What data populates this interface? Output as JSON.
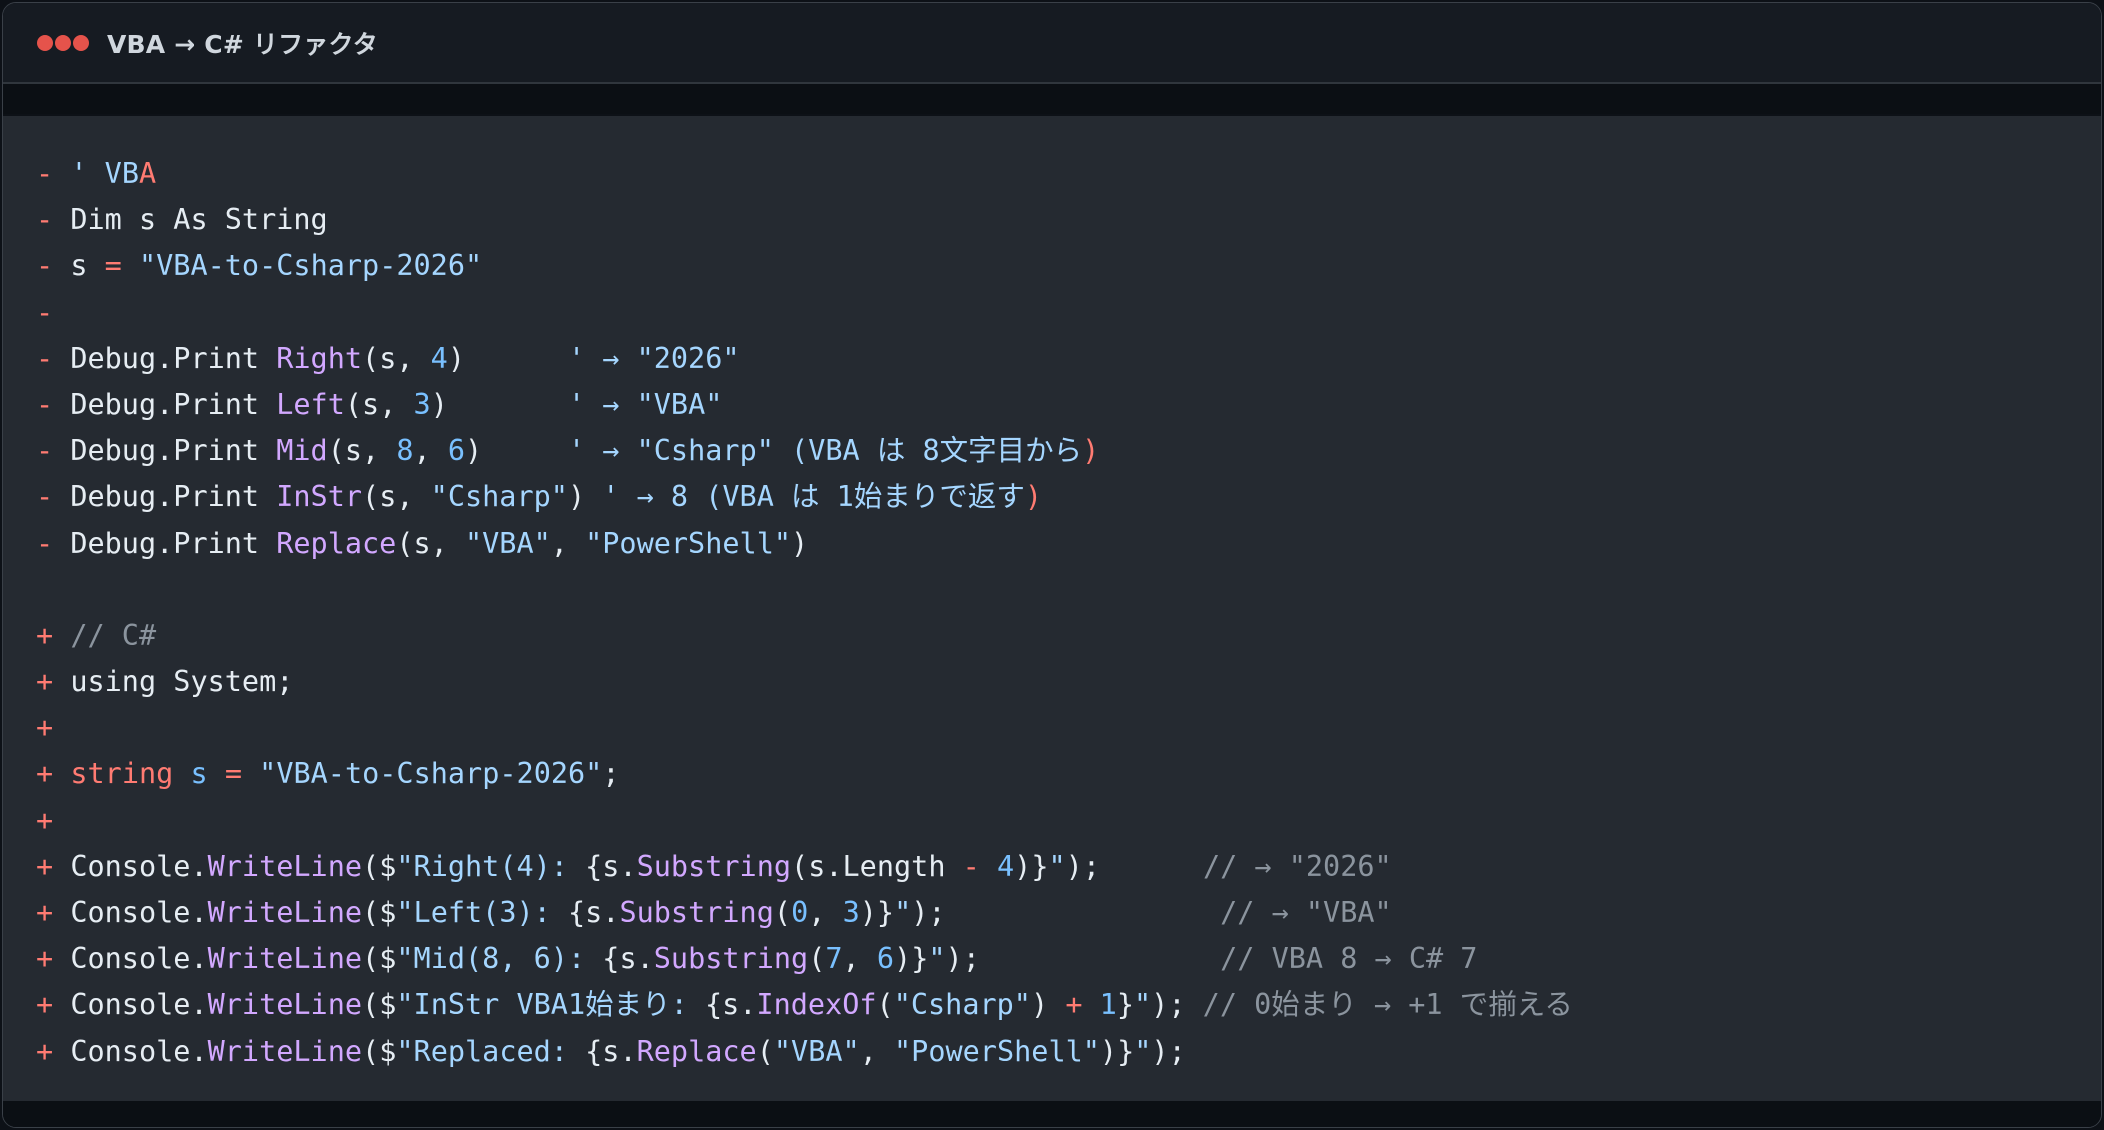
{
  "window": {
    "title": "VBA → C# リファクタ",
    "dots": [
      "#e5534b",
      "#e5534b",
      "#e5534b"
    ]
  },
  "diff_lines": [
    {
      "marker": "-",
      "tokens": [
        {
          "t": " ",
          "c": "t"
        },
        {
          "t": "' VB",
          "c": "s"
        },
        {
          "t": "A",
          "c": "m"
        }
      ]
    },
    {
      "marker": "-",
      "tokens": [
        {
          "t": " Dim s As String",
          "c": "t"
        }
      ]
    },
    {
      "marker": "-",
      "tokens": [
        {
          "t": " s ",
          "c": "t"
        },
        {
          "t": "=",
          "c": "k"
        },
        {
          "t": " \"VBA-to-Csharp-2026\"",
          "c": "s"
        }
      ]
    },
    {
      "marker": "-",
      "tokens": []
    },
    {
      "marker": "-",
      "tokens": [
        {
          "t": " Debug.Print ",
          "c": "t"
        },
        {
          "t": "Right",
          "c": "f"
        },
        {
          "t": "(s, ",
          "c": "t"
        },
        {
          "t": "4",
          "c": "n"
        },
        {
          "t": ")      ",
          "c": "t"
        },
        {
          "t": "' → \"2026\"",
          "c": "s"
        }
      ]
    },
    {
      "marker": "-",
      "tokens": [
        {
          "t": " Debug.Print ",
          "c": "t"
        },
        {
          "t": "Left",
          "c": "f"
        },
        {
          "t": "(s, ",
          "c": "t"
        },
        {
          "t": "3",
          "c": "n"
        },
        {
          "t": ")       ",
          "c": "t"
        },
        {
          "t": "' → \"VBA\"",
          "c": "s"
        }
      ]
    },
    {
      "marker": "-",
      "tokens": [
        {
          "t": " Debug.Print ",
          "c": "t"
        },
        {
          "t": "Mid",
          "c": "f"
        },
        {
          "t": "(s, ",
          "c": "t"
        },
        {
          "t": "8",
          "c": "n"
        },
        {
          "t": ", ",
          "c": "t"
        },
        {
          "t": "6",
          "c": "n"
        },
        {
          "t": ")     ",
          "c": "t"
        },
        {
          "t": "' → \"Csharp\" (VBA は 8文字目から",
          "c": "s"
        },
        {
          "t": ")",
          "c": "m"
        }
      ]
    },
    {
      "marker": "-",
      "tokens": [
        {
          "t": " Debug.Print ",
          "c": "t"
        },
        {
          "t": "InStr",
          "c": "f"
        },
        {
          "t": "(s, ",
          "c": "t"
        },
        {
          "t": "\"Csharp\"",
          "c": "s"
        },
        {
          "t": ") ",
          "c": "t"
        },
        {
          "t": "' → 8 (VBA は 1始まりで返す",
          "c": "s"
        },
        {
          "t": ")",
          "c": "m"
        }
      ]
    },
    {
      "marker": "-",
      "tokens": [
        {
          "t": " Debug.Print ",
          "c": "t"
        },
        {
          "t": "Replace",
          "c": "f"
        },
        {
          "t": "(s, ",
          "c": "t"
        },
        {
          "t": "\"VBA\"",
          "c": "s"
        },
        {
          "t": ", ",
          "c": "t"
        },
        {
          "t": "\"PowerShell\"",
          "c": "s"
        },
        {
          "t": ")",
          "c": "t"
        }
      ]
    },
    {
      "marker": "",
      "tokens": []
    },
    {
      "marker": "+",
      "tokens": [
        {
          "t": " // C#",
          "c": "c"
        }
      ]
    },
    {
      "marker": "+",
      "tokens": [
        {
          "t": " using System;",
          "c": "t"
        }
      ]
    },
    {
      "marker": "+",
      "tokens": []
    },
    {
      "marker": "+",
      "tokens": [
        {
          "t": " ",
          "c": "t"
        },
        {
          "t": "string",
          "c": "k"
        },
        {
          "t": " ",
          "c": "t"
        },
        {
          "t": "s",
          "c": "n"
        },
        {
          "t": " ",
          "c": "t"
        },
        {
          "t": "=",
          "c": "k"
        },
        {
          "t": " ",
          "c": "t"
        },
        {
          "t": "\"VBA-to-Csharp-2026\"",
          "c": "s"
        },
        {
          "t": ";",
          "c": "t"
        }
      ]
    },
    {
      "marker": "+",
      "tokens": []
    },
    {
      "marker": "+",
      "tokens": [
        {
          "t": " Console.",
          "c": "t"
        },
        {
          "t": "WriteLine",
          "c": "f"
        },
        {
          "t": "($",
          "c": "t"
        },
        {
          "t": "\"Right(4): ",
          "c": "s"
        },
        {
          "t": "{s.",
          "c": "t"
        },
        {
          "t": "Substring",
          "c": "f"
        },
        {
          "t": "(s.Length ",
          "c": "t"
        },
        {
          "t": "-",
          "c": "k"
        },
        {
          "t": " ",
          "c": "t"
        },
        {
          "t": "4",
          "c": "n"
        },
        {
          "t": ")}",
          "c": "t"
        },
        {
          "t": "\"",
          "c": "s"
        },
        {
          "t": ");      ",
          "c": "t"
        },
        {
          "t": "// → \"2026\"",
          "c": "c"
        }
      ]
    },
    {
      "marker": "+",
      "tokens": [
        {
          "t": " Console.",
          "c": "t"
        },
        {
          "t": "WriteLine",
          "c": "f"
        },
        {
          "t": "($",
          "c": "t"
        },
        {
          "t": "\"Left(3): ",
          "c": "s"
        },
        {
          "t": "{s.",
          "c": "t"
        },
        {
          "t": "Substring",
          "c": "f"
        },
        {
          "t": "(",
          "c": "t"
        },
        {
          "t": "0",
          "c": "n"
        },
        {
          "t": ", ",
          "c": "t"
        },
        {
          "t": "3",
          "c": "n"
        },
        {
          "t": ")}",
          "c": "t"
        },
        {
          "t": "\"",
          "c": "s"
        },
        {
          "t": ");                ",
          "c": "t"
        },
        {
          "t": "// → \"VBA\"",
          "c": "c"
        }
      ]
    },
    {
      "marker": "+",
      "tokens": [
        {
          "t": " Console.",
          "c": "t"
        },
        {
          "t": "WriteLine",
          "c": "f"
        },
        {
          "t": "($",
          "c": "t"
        },
        {
          "t": "\"Mid(8, 6): ",
          "c": "s"
        },
        {
          "t": "{s.",
          "c": "t"
        },
        {
          "t": "Substring",
          "c": "f"
        },
        {
          "t": "(",
          "c": "t"
        },
        {
          "t": "7",
          "c": "n"
        },
        {
          "t": ", ",
          "c": "t"
        },
        {
          "t": "6",
          "c": "n"
        },
        {
          "t": ")}",
          "c": "t"
        },
        {
          "t": "\"",
          "c": "s"
        },
        {
          "t": ");              ",
          "c": "t"
        },
        {
          "t": "// VBA 8 → C# 7",
          "c": "c"
        }
      ]
    },
    {
      "marker": "+",
      "tokens": [
        {
          "t": " Console.",
          "c": "t"
        },
        {
          "t": "WriteLine",
          "c": "f"
        },
        {
          "t": "($",
          "c": "t"
        },
        {
          "t": "\"InStr VBA1始まり: ",
          "c": "s"
        },
        {
          "t": "{s.",
          "c": "t"
        },
        {
          "t": "IndexOf",
          "c": "f"
        },
        {
          "t": "(",
          "c": "t"
        },
        {
          "t": "\"Csharp\"",
          "c": "s"
        },
        {
          "t": ") ",
          "c": "t"
        },
        {
          "t": "+",
          "c": "k"
        },
        {
          "t": " ",
          "c": "t"
        },
        {
          "t": "1",
          "c": "n"
        },
        {
          "t": "}",
          "c": "t"
        },
        {
          "t": "\"",
          "c": "s"
        },
        {
          "t": "); ",
          "c": "t"
        },
        {
          "t": "// 0始まり → +1 で揃える",
          "c": "c"
        }
      ]
    },
    {
      "marker": "+",
      "tokens": [
        {
          "t": " Console.",
          "c": "t"
        },
        {
          "t": "WriteLine",
          "c": "f"
        },
        {
          "t": "($",
          "c": "t"
        },
        {
          "t": "\"Replaced: ",
          "c": "s"
        },
        {
          "t": "{s.",
          "c": "t"
        },
        {
          "t": "Replace",
          "c": "f"
        },
        {
          "t": "(",
          "c": "t"
        },
        {
          "t": "\"VBA\"",
          "c": "s"
        },
        {
          "t": ", ",
          "c": "t"
        },
        {
          "t": "\"PowerShell\"",
          "c": "s"
        },
        {
          "t": ")}",
          "c": "t"
        },
        {
          "t": "\"",
          "c": "s"
        },
        {
          "t": ");",
          "c": "t"
        }
      ]
    }
  ]
}
